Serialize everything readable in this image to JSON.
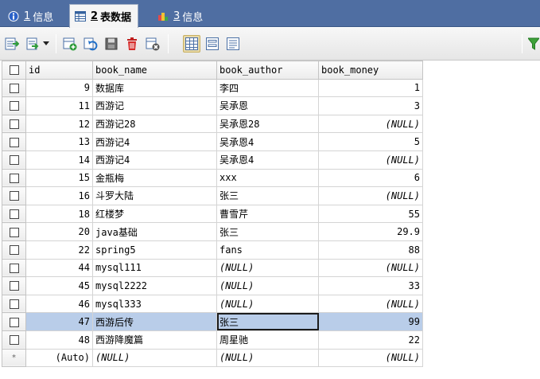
{
  "tabs": [
    {
      "num": "1",
      "label": "信息",
      "active": false,
      "icon": "info-icon"
    },
    {
      "num": "2",
      "label": "表数据",
      "active": true,
      "icon": "table-data-icon"
    },
    {
      "num": "3",
      "label": "信息",
      "active": false,
      "icon": "info-chart-icon"
    }
  ],
  "toolbar": {
    "icons": [
      "export-icon",
      "import-icon",
      "dropdown-arrow-icon",
      "add-row-icon",
      "refresh-icon",
      "save-icon",
      "delete-icon",
      "cancel-icon",
      "grid-view-icon",
      "form-view-icon",
      "text-view-icon",
      "filter-icon"
    ]
  },
  "table": {
    "columns": [
      "id",
      "book_name",
      "book_author",
      "book_money"
    ],
    "rows": [
      {
        "id": "9",
        "book_name": "数据库",
        "book_author": "李四",
        "book_money": "1"
      },
      {
        "id": "11",
        "book_name": "西游记",
        "book_author": "吴承恩",
        "book_money": "3"
      },
      {
        "id": "12",
        "book_name": "西游记28",
        "book_author": "吴承恩28",
        "book_money": "(NULL)"
      },
      {
        "id": "13",
        "book_name": "西游记4",
        "book_author": "吴承恩4",
        "book_money": "5"
      },
      {
        "id": "14",
        "book_name": "西游记4",
        "book_author": "吴承恩4",
        "book_money": "(NULL)"
      },
      {
        "id": "15",
        "book_name": "金瓶梅",
        "book_author": "xxx",
        "book_money": "6"
      },
      {
        "id": "16",
        "book_name": "斗罗大陆",
        "book_author": "张三",
        "book_money": "(NULL)"
      },
      {
        "id": "18",
        "book_name": "红楼梦",
        "book_author": "曹雪芹",
        "book_money": "55"
      },
      {
        "id": "20",
        "book_name": "java基础",
        "book_author": "张三",
        "book_money": "29.9"
      },
      {
        "id": "22",
        "book_name": "spring5",
        "book_author": "fans",
        "book_money": "88"
      },
      {
        "id": "44",
        "book_name": "mysql111",
        "book_author": "(NULL)",
        "book_money": "(NULL)"
      },
      {
        "id": "45",
        "book_name": "mysql2222",
        "book_author": "(NULL)",
        "book_money": "33"
      },
      {
        "id": "46",
        "book_name": "mysql333",
        "book_author": "(NULL)",
        "book_money": "(NULL)"
      },
      {
        "id": "47",
        "book_name": "西游后传",
        "book_author": "张三",
        "book_money": "99"
      },
      {
        "id": "48",
        "book_name": "西游降魔篇",
        "book_author": "周星驰",
        "book_money": "22"
      }
    ],
    "new_row": {
      "marker": "*",
      "id": "(Auto)",
      "book_name": "(NULL)",
      "book_author": "(NULL)",
      "book_money": "(NULL)"
    },
    "selected_row_id": "47",
    "focused_column": "book_author",
    "colors": {
      "selection": "#b9cde9",
      "tabbar": "#4f6ea2"
    }
  }
}
